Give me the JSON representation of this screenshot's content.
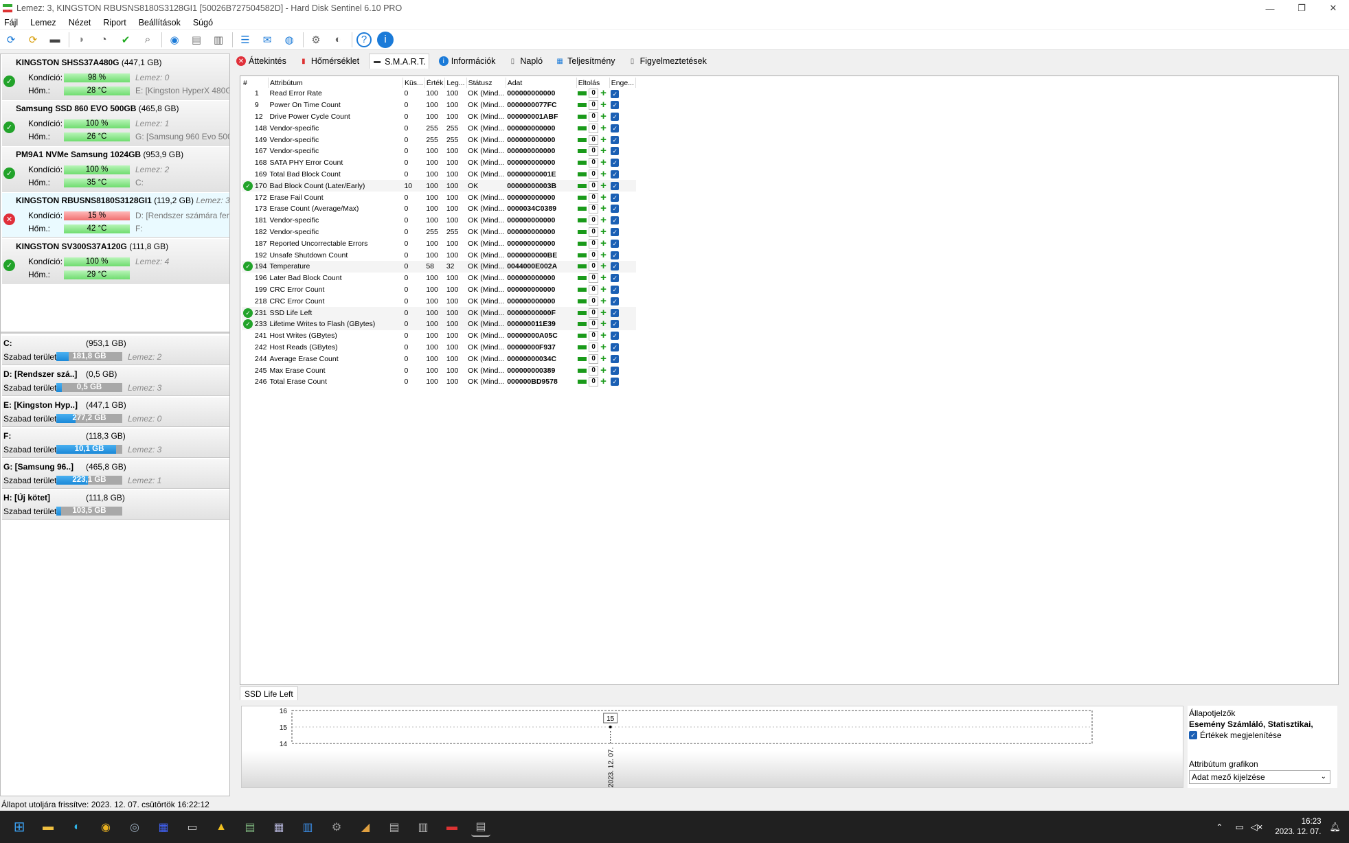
{
  "window": {
    "title": "Lemez: 3, KINGSTON RBUSNS8180S3128GI1 [50026B727504582D]  -  Hard Disk Sentinel 6.10 PRO"
  },
  "menu": [
    "Fájl",
    "Lemez",
    "Nézet",
    "Riport",
    "Beállítások",
    "Súgó"
  ],
  "labels": {
    "kondicio": "Kondíció:",
    "hom": "Hőm.:",
    "szabad": "Szabad terület"
  },
  "disks": [
    {
      "name": "KINGSTON SHSS37A480G",
      "size": "(447,1 GB)",
      "lemez": "",
      "health": "98 %",
      "health_pct": 98,
      "temp": "28 °C",
      "info1": "Lemez: 0",
      "info2": "E: [Kingston HyperX 480Gb]",
      "status": "ok"
    },
    {
      "name": "Samsung SSD 860 EVO 500GB",
      "size": "(465,8 GB)",
      "lemez": "",
      "health": "100 %",
      "health_pct": 100,
      "temp": "26 °C",
      "info1": "Lemez: 1",
      "info2": "G: [Samsung 960 Evo 500GB]",
      "status": "ok"
    },
    {
      "name": "PM9A1 NVMe Samsung 1024GB",
      "size": "(953,9 GB)",
      "lemez": "",
      "health": "100 %",
      "health_pct": 100,
      "temp": "35 °C",
      "info1": "Lemez: 2",
      "info2": "C:",
      "status": "ok"
    },
    {
      "name": "KINGSTON RBUSNS8180S3128GI1",
      "size": "(119,2 GB)",
      "lemez": "Lemez: 3",
      "health": "15 %",
      "health_pct": 15,
      "temp": "42 °C",
      "info1": "D: [Rendszer számára fenntartott]",
      "info2": "F:",
      "status": "bad"
    },
    {
      "name": "KINGSTON SV300S37A120G",
      "size": "(111,8 GB)",
      "lemez": "",
      "health": "100 %",
      "health_pct": 100,
      "temp": "29 °C",
      "info1": "Lemez: 4",
      "info2": "",
      "status": "ok"
    }
  ],
  "volumes": [
    {
      "name": "C:",
      "size": "(953,1 GB)",
      "free": "181,8 GB",
      "free_pct": 19,
      "lemez": "Lemez: 2"
    },
    {
      "name": "D: [Rendszer szá..]",
      "size": "(0,5 GB)",
      "free": "0,5 GB",
      "free_pct": 8,
      "lemez": "Lemez: 3"
    },
    {
      "name": "E: [Kingston Hyp..]",
      "size": "(447,1 GB)",
      "free": "277,2 GB",
      "free_pct": 29,
      "lemez": "Lemez: 0"
    },
    {
      "name": "F:",
      "size": "(118,3 GB)",
      "free": "10,1 GB",
      "free_pct": 91,
      "lemez": "Lemez: 3"
    },
    {
      "name": "G: [Samsung 96..]",
      "size": "(465,8 GB)",
      "free": "223,1 GB",
      "free_pct": 48,
      "lemez": "Lemez: 1"
    },
    {
      "name": "H: [Új kötet]",
      "size": "(111,8 GB)",
      "free": "103,5 GB",
      "free_pct": 7,
      "lemez": ""
    }
  ],
  "tabs": [
    "Áttekintés",
    "Hőmérséklet",
    "S.M.A.R.T.",
    "Információk",
    "Napló",
    "Teljesítmény",
    "Figyelmeztetések"
  ],
  "smart_headers": [
    "#",
    "Attribútum",
    "Küs...",
    "Érték",
    "Leg...",
    "Státusz",
    "Adat",
    "Eltolás",
    "Enge..."
  ],
  "smart_rows": [
    {
      "id": "1",
      "name": "Read Error Rate",
      "th": "0",
      "val": "100",
      "worst": "100",
      "status": "OK (Mind...",
      "data": "000000000000",
      "flag": false
    },
    {
      "id": "9",
      "name": "Power On Time Count",
      "th": "0",
      "val": "100",
      "worst": "100",
      "status": "OK (Mind...",
      "data": "0000000077FC",
      "flag": false
    },
    {
      "id": "12",
      "name": "Drive Power Cycle Count",
      "th": "0",
      "val": "100",
      "worst": "100",
      "status": "OK (Mind...",
      "data": "000000001ABF",
      "flag": false
    },
    {
      "id": "148",
      "name": "Vendor-specific",
      "th": "0",
      "val": "255",
      "worst": "255",
      "status": "OK (Mind...",
      "data": "000000000000",
      "flag": false
    },
    {
      "id": "149",
      "name": "Vendor-specific",
      "th": "0",
      "val": "255",
      "worst": "255",
      "status": "OK (Mind...",
      "data": "000000000000",
      "flag": false
    },
    {
      "id": "167",
      "name": "Vendor-specific",
      "th": "0",
      "val": "100",
      "worst": "100",
      "status": "OK (Mind...",
      "data": "000000000000",
      "flag": false
    },
    {
      "id": "168",
      "name": "SATA PHY Error Count",
      "th": "0",
      "val": "100",
      "worst": "100",
      "status": "OK (Mind...",
      "data": "000000000000",
      "flag": false
    },
    {
      "id": "169",
      "name": "Total Bad Block Count",
      "th": "0",
      "val": "100",
      "worst": "100",
      "status": "OK (Mind...",
      "data": "00000000001E",
      "flag": false
    },
    {
      "id": "170",
      "name": "Bad Block Count (Later/Early)",
      "th": "10",
      "val": "100",
      "worst": "100",
      "status": "OK",
      "data": "00000000003B",
      "flag": true
    },
    {
      "id": "172",
      "name": "Erase Fail Count",
      "th": "0",
      "val": "100",
      "worst": "100",
      "status": "OK (Mind...",
      "data": "000000000000",
      "flag": false
    },
    {
      "id": "173",
      "name": "Erase Count (Average/Max)",
      "th": "0",
      "val": "100",
      "worst": "100",
      "status": "OK (Mind...",
      "data": "0000034C0389",
      "flag": false
    },
    {
      "id": "181",
      "name": "Vendor-specific",
      "th": "0",
      "val": "100",
      "worst": "100",
      "status": "OK (Mind...",
      "data": "000000000000",
      "flag": false
    },
    {
      "id": "182",
      "name": "Vendor-specific",
      "th": "0",
      "val": "255",
      "worst": "255",
      "status": "OK (Mind...",
      "data": "000000000000",
      "flag": false
    },
    {
      "id": "187",
      "name": "Reported Uncorrectable Errors",
      "th": "0",
      "val": "100",
      "worst": "100",
      "status": "OK (Mind...",
      "data": "000000000000",
      "flag": false
    },
    {
      "id": "192",
      "name": "Unsafe Shutdown Count",
      "th": "0",
      "val": "100",
      "worst": "100",
      "status": "OK (Mind...",
      "data": "0000000000BE",
      "flag": false
    },
    {
      "id": "194",
      "name": "Temperature",
      "th": "0",
      "val": "58",
      "worst": "32",
      "status": "OK (Mind...",
      "data": "0044000E002A",
      "flag": true
    },
    {
      "id": "196",
      "name": "Later Bad Block Count",
      "th": "0",
      "val": "100",
      "worst": "100",
      "status": "OK (Mind...",
      "data": "000000000000",
      "flag": false
    },
    {
      "id": "199",
      "name": "CRC Error Count",
      "th": "0",
      "val": "100",
      "worst": "100",
      "status": "OK (Mind...",
      "data": "000000000000",
      "flag": false
    },
    {
      "id": "218",
      "name": "CRC Error Count",
      "th": "0",
      "val": "100",
      "worst": "100",
      "status": "OK (Mind...",
      "data": "000000000000",
      "flag": false
    },
    {
      "id": "231",
      "name": "SSD Life Left",
      "th": "0",
      "val": "100",
      "worst": "100",
      "status": "OK (Mind...",
      "data": "00000000000F",
      "flag": true
    },
    {
      "id": "233",
      "name": "Lifetime Writes to Flash (GBytes)",
      "th": "0",
      "val": "100",
      "worst": "100",
      "status": "OK (Mind...",
      "data": "000000011E39",
      "flag": true
    },
    {
      "id": "241",
      "name": "Host Writes (GBytes)",
      "th": "0",
      "val": "100",
      "worst": "100",
      "status": "OK (Mind...",
      "data": "00000000A05C",
      "flag": false
    },
    {
      "id": "242",
      "name": "Host Reads (GBytes)",
      "th": "0",
      "val": "100",
      "worst": "100",
      "status": "OK (Mind...",
      "data": "00000000F937",
      "flag": false
    },
    {
      "id": "244",
      "name": "Average Erase Count",
      "th": "0",
      "val": "100",
      "worst": "100",
      "status": "OK (Mind...",
      "data": "00000000034C",
      "flag": false
    },
    {
      "id": "245",
      "name": "Max Erase Count",
      "th": "0",
      "val": "100",
      "worst": "100",
      "status": "OK (Mind...",
      "data": "000000000389",
      "flag": false
    },
    {
      "id": "246",
      "name": "Total Erase Count",
      "th": "0",
      "val": "100",
      "worst": "100",
      "status": "OK (Mind...",
      "data": "000000BD9578",
      "flag": false
    }
  ],
  "offset_value": "0",
  "graph": {
    "tab": "SSD Life Left",
    "yticks": [
      "16",
      "15",
      "14"
    ],
    "point_label": "15",
    "xdate": "2023. 12. 07.",
    "status_title": "Állapotjelzők",
    "status_bold": "Esemény Számláló, Statisztikai,",
    "show_values": "Értékek megjelenítése",
    "attr_graph": "Attribútum grafikon",
    "attr_select": "Adat mező kijelzése"
  },
  "chart_data": {
    "type": "line",
    "x": [
      "2023. 12. 07."
    ],
    "series": [
      {
        "values": [
          15
        ]
      }
    ],
    "ylim": [
      14,
      16
    ],
    "yticks": [
      14,
      15,
      16
    ]
  },
  "statusbar": "Állapot utoljára frissítve: 2023. 12. 07. csütörtök 16:22:12",
  "clock": {
    "time": "16:23",
    "date": "2023. 12. 07."
  }
}
